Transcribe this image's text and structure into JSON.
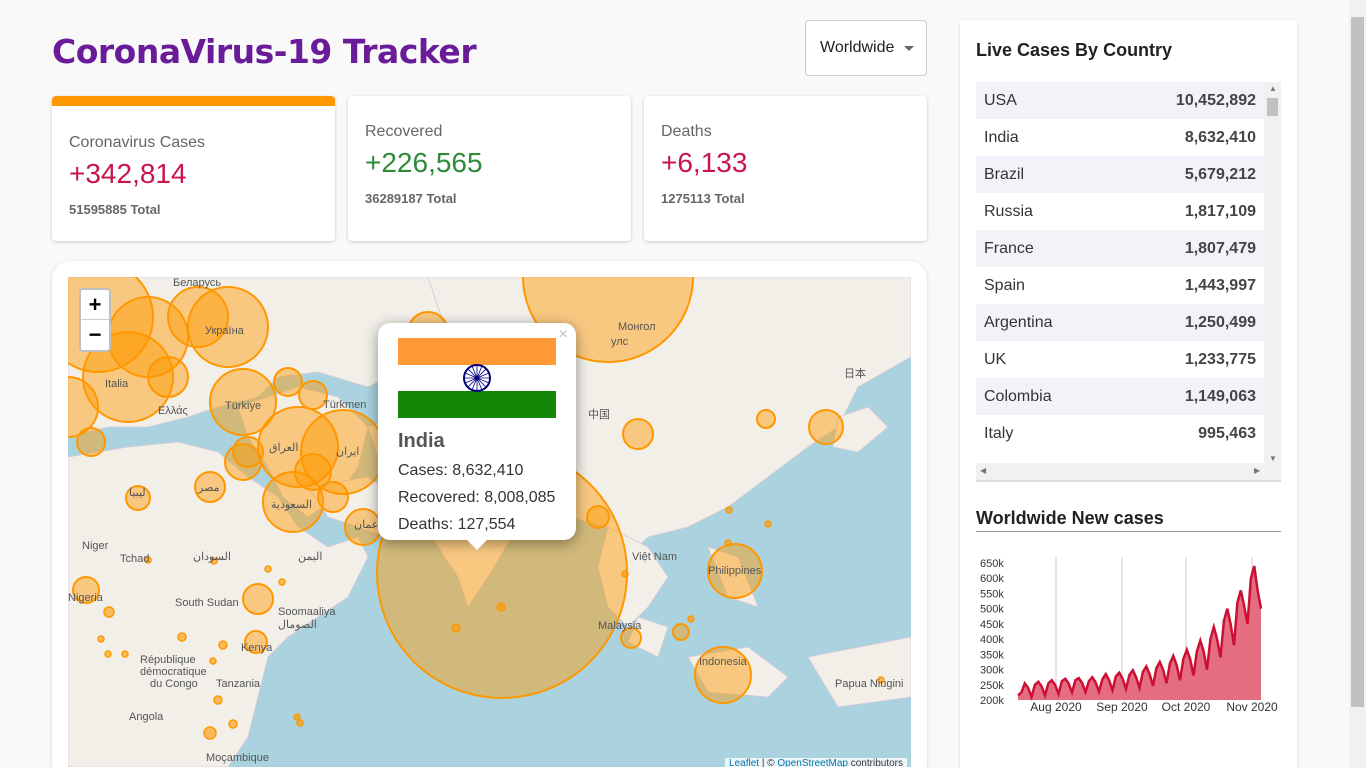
{
  "app": {
    "title": "CoronaVirus-19 Tracker"
  },
  "country_select": {
    "value": "Worldwide"
  },
  "cards": [
    {
      "title": "Coronavirus Cases",
      "value": "+342,814",
      "total": "51595885 Total"
    },
    {
      "title": "Recovered",
      "value": "+226,565",
      "total": "36289187 Total"
    },
    {
      "title": "Deaths",
      "value": "+6,133",
      "total": "1275113 Total"
    }
  ],
  "map": {
    "zoom_in": "+",
    "zoom_out": "−",
    "labels": [
      "Беларусь",
      "Україна",
      "Italia",
      "Türkiye",
      "Ελλάς",
      "Türkmen",
      "العراق",
      "ایران",
      "السعودية",
      "مصر",
      "ليبيا",
      "عمان",
      "اليمن",
      "السودان",
      "South Sudan",
      "Soomaaliya",
      "الصومال",
      "Niger",
      "Tchad",
      "Nigeria",
      "République démocratique du Congo",
      "Kenya",
      "Tanzania",
      "Angola",
      "Moçambique",
      "Монгол",
      "улс",
      "中国",
      "日本",
      "Việt Nam",
      "Philippines",
      "Malaysia",
      "Indonesia",
      "Papua Niugini"
    ],
    "popup": {
      "close": "×",
      "country": "India",
      "cases": "Cases: 8,632,410",
      "recovered": "Recovered: 8,008,085",
      "deaths": "Deaths: 127,554"
    },
    "attribution": {
      "leaflet": "Leaflet",
      "sep": " | © ",
      "osm": "OpenStreetMap",
      "suffix": " contributors"
    },
    "colors": {
      "water": "#aad3df",
      "land": "#f2efe9",
      "circle": "#ff9800",
      "flag_saffron": "#ff9933",
      "flag_green": "#138808",
      "chakra": "#000080"
    }
  },
  "side": {
    "table_title": "Live Cases By Country",
    "rows": [
      {
        "country": "USA",
        "cases": "10,452,892"
      },
      {
        "country": "India",
        "cases": "8,632,410"
      },
      {
        "country": "Brazil",
        "cases": "5,679,212"
      },
      {
        "country": "Russia",
        "cases": "1,817,109"
      },
      {
        "country": "France",
        "cases": "1,807,479"
      },
      {
        "country": "Spain",
        "cases": "1,443,997"
      },
      {
        "country": "Argentina",
        "cases": "1,250,499"
      },
      {
        "country": "UK",
        "cases": "1,233,775"
      },
      {
        "country": "Colombia",
        "cases": "1,149,063"
      },
      {
        "country": "Italy",
        "cases": "995,463"
      }
    ],
    "chart_title": "Worldwide New cases"
  },
  "chart_data": {
    "type": "area",
    "title": "Worldwide New cases",
    "xlabel": "",
    "ylabel": "",
    "y_ticks": [
      "650k",
      "600k",
      "550k",
      "500k",
      "450k",
      "400k",
      "350k",
      "300k",
      "250k",
      "200k"
    ],
    "x_ticks": [
      "Aug 2020",
      "Sep 2020",
      "Oct 2020",
      "Nov 2020"
    ],
    "ylim": [
      200000,
      650000
    ],
    "colors": {
      "line": "#cc1034",
      "fill": "#e46d82"
    },
    "series": [
      {
        "values": [
          215000,
          225000,
          255000,
          240000,
          210000,
          250000,
          260000,
          245000,
          215000,
          255000,
          265000,
          250000,
          220000,
          262000,
          270000,
          255000,
          225000,
          265000,
          272000,
          256000,
          226000,
          262000,
          275000,
          258000,
          228000,
          268000,
          285000,
          265000,
          232000,
          278000,
          290000,
          270000,
          236000,
          282000,
          298000,
          275000,
          240000,
          292000,
          310000,
          285000,
          246000,
          305000,
          325000,
          300000,
          255000,
          320000,
          345000,
          315000,
          265000,
          335000,
          365000,
          335000,
          280000,
          360000,
          395000,
          360000,
          300000,
          400000,
          440000,
          400000,
          340000,
          460000,
          500000,
          450000,
          380000,
          520000,
          560000,
          510000,
          450000,
          600000,
          640000,
          560000,
          500000
        ]
      }
    ]
  }
}
